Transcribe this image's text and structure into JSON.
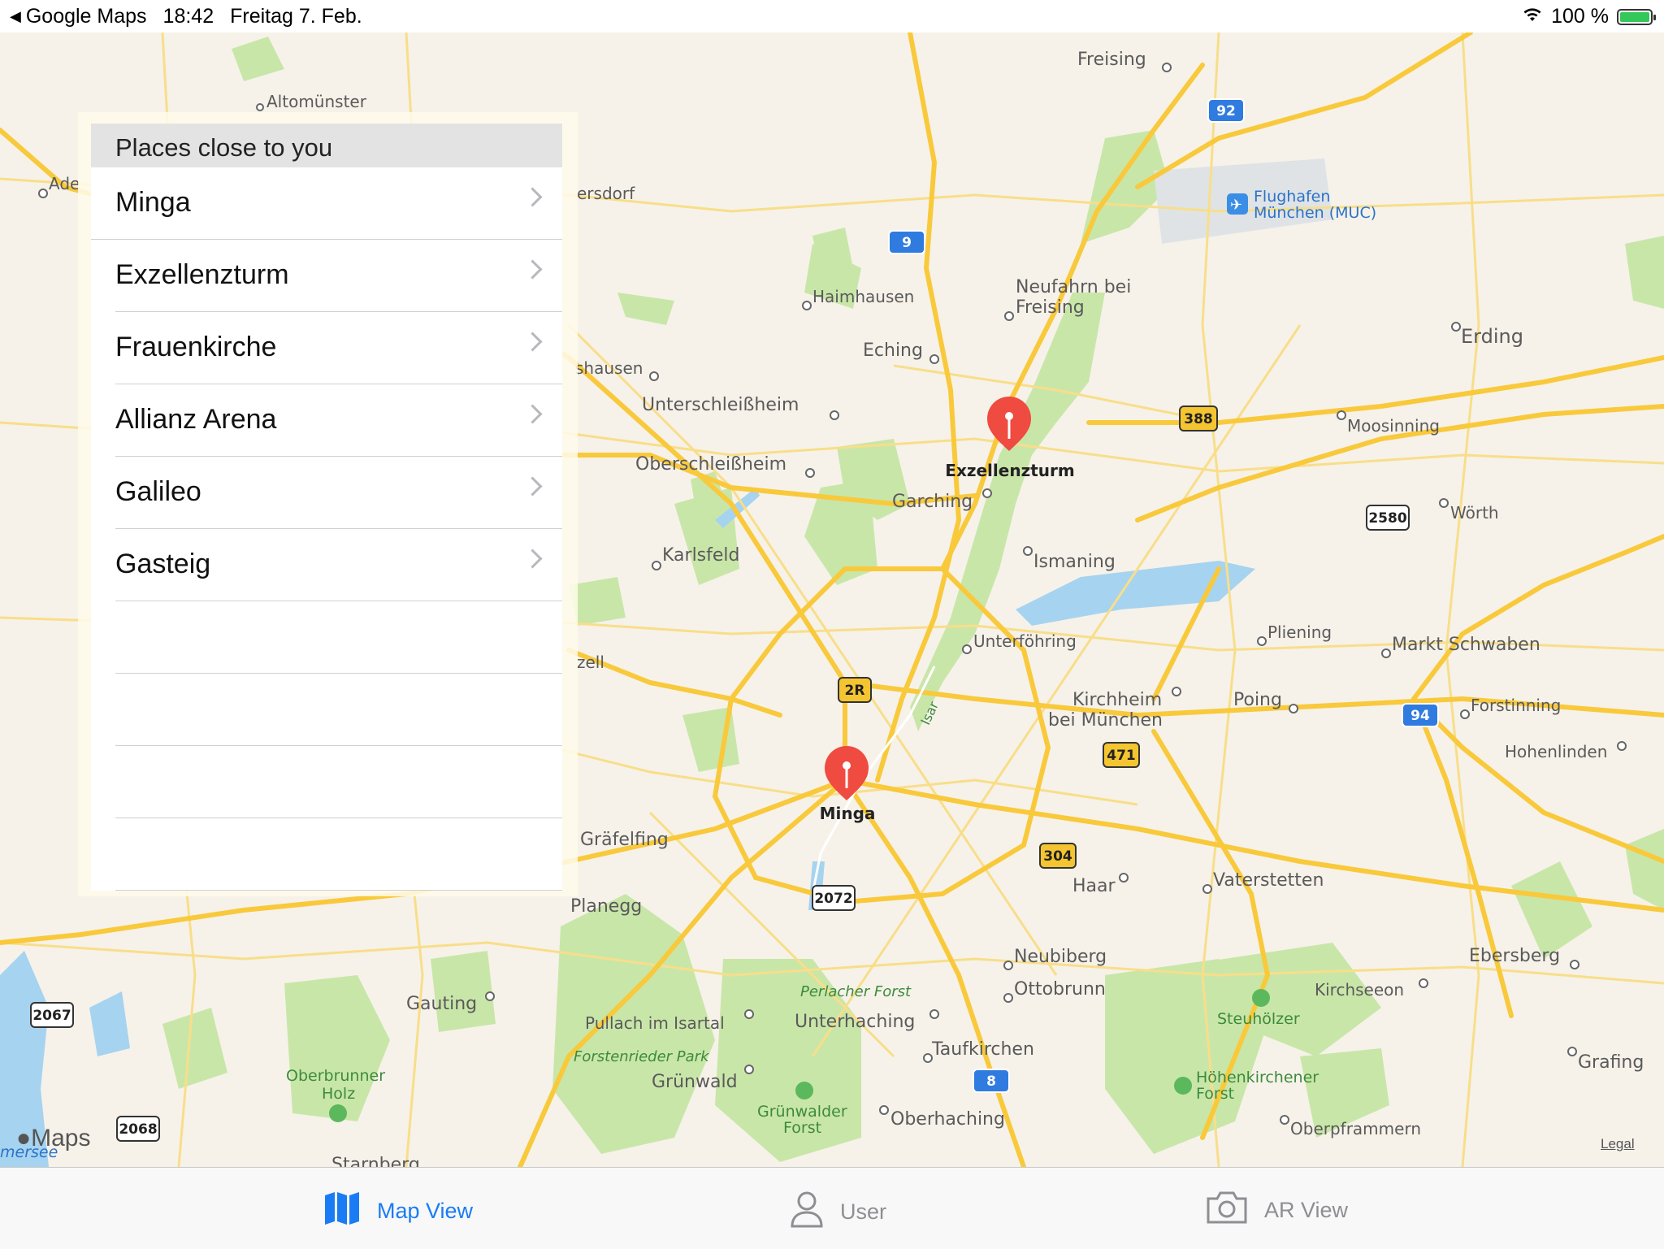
{
  "status_bar": {
    "back_app": "Google Maps",
    "time": "18:42",
    "date": "Freitag 7. Feb.",
    "battery": "100 %"
  },
  "panel": {
    "title": "Places close to you",
    "places": [
      "Minga",
      "Exzellenzturm",
      "Frauenkirche",
      "Allianz Arena",
      "Galileo",
      "Gasteig"
    ]
  },
  "map": {
    "labels": {
      "freising": "Freising",
      "altomuenster": "Altomünster",
      "ade": "Ade",
      "ersdorf": "ersdorf",
      "flughafen_1": "Flughafen",
      "flughafen_2": "München (MUC)",
      "haimhausen": "Haimhausen",
      "neufahrn_1": "Neufahrn bei",
      "neufahrn_2": "Freising",
      "erding": "Erding",
      "eching": "Eching",
      "shausen": "shausen",
      "unterschleissheim": "Unterschleißheim",
      "moosinning": "Moosinning",
      "oberschleissheim": "Oberschleißheim",
      "garching": "Garching",
      "woerth": "Wörth",
      "karlsfeld": "Karlsfeld",
      "ismaning": "Ismaning",
      "unterfoehring": "Unterföhring",
      "pliening": "Pliening",
      "markt_schwaben": "Markt Schwaben",
      "zell": "zell",
      "kirchheim_1": "Kirchheim",
      "kirchheim_2": "bei München",
      "poing": "Poing",
      "forstinning": "Forstinning",
      "hohenlinden": "Hohenlinden",
      "isar": "Isar",
      "graefelfing": "Gräfelfing",
      "haar": "Haar",
      "vaterstetten": "Vaterstetten",
      "planegg": "Planegg",
      "neubiberg": "Neubiberg",
      "ebersberg": "Ebersberg",
      "ottobrunn": "Ottobrunn",
      "kirchseeon": "Kirchseeon",
      "gauting": "Gauting",
      "perlacher_forst": "Perlacher Forst",
      "pullach": "Pullach im Isartal",
      "unterhaching": "Unterhaching",
      "steuhoelzer": "Steuhölzer",
      "taufkirchen": "Taufkirchen",
      "forstenrieder_park": "Forstenrieder Park",
      "oberbrunner_1": "Oberbrunner",
      "oberbrunner_2": "Holz",
      "gruenwald": "Grünwald",
      "hoehenkirchener_1": "Höhenkirchener",
      "hoehenkirchener_2": "Forst",
      "grafing": "Grafing",
      "gruenwalder_1": "Grünwalder",
      "gruenwalder_2": "Forst",
      "oberhaching": "Oberhaching",
      "oberpframmern": "Oberpframmern",
      "starnberg": "Starnberg",
      "mersee": "mersee"
    },
    "pins": [
      "Exzellenzturm",
      "Minga"
    ],
    "shields": {
      "a92": "92",
      "a9": "9",
      "b388": "388",
      "r2580": "2580",
      "r2r": "2R",
      "a94": "94",
      "b471": "471",
      "b304": "304",
      "r2072": "2072",
      "r2067": "2067",
      "a8": "8",
      "r2068": "2068"
    },
    "logo": "Maps",
    "legal": "Legal"
  },
  "tabbar": {
    "tabs": [
      {
        "label": "Map View",
        "icon": "map-icon",
        "selected": true
      },
      {
        "label": "User",
        "icon": "person-icon",
        "selected": false
      },
      {
        "label": "AR View",
        "icon": "camera-icon",
        "selected": false
      }
    ],
    "accent": "#1a7cf5",
    "inactive": "#8e8e93"
  },
  "colors": {
    "pin": "#ef4b41",
    "road_major": "#f9c93c",
    "map_bg": "#f6f2e9",
    "green": "#c9e6a9",
    "water": "#a6d3f0"
  }
}
